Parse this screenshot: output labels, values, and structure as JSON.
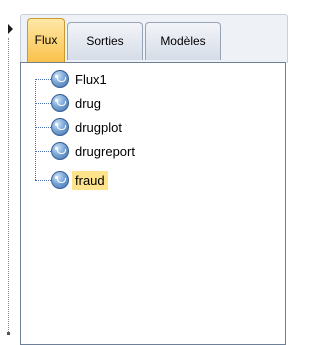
{
  "tabs": [
    {
      "label": "Flux",
      "active": true
    },
    {
      "label": "Sorties",
      "active": false
    },
    {
      "label": "Modèles",
      "active": false
    }
  ],
  "tree": {
    "items": [
      {
        "label": "Flux1",
        "icon": "stream-icon"
      },
      {
        "label": "drug",
        "icon": "stream-icon"
      },
      {
        "label": "drugplot",
        "icon": "stream-icon"
      },
      {
        "label": "drugreport",
        "icon": "stream-icon"
      },
      {
        "label": "fraud",
        "icon": "stream-icon",
        "selected": true
      }
    ]
  },
  "colors": {
    "active_tab": "#f9c24a",
    "selection": "#fde38b",
    "panel_border": "#6f7f96"
  }
}
